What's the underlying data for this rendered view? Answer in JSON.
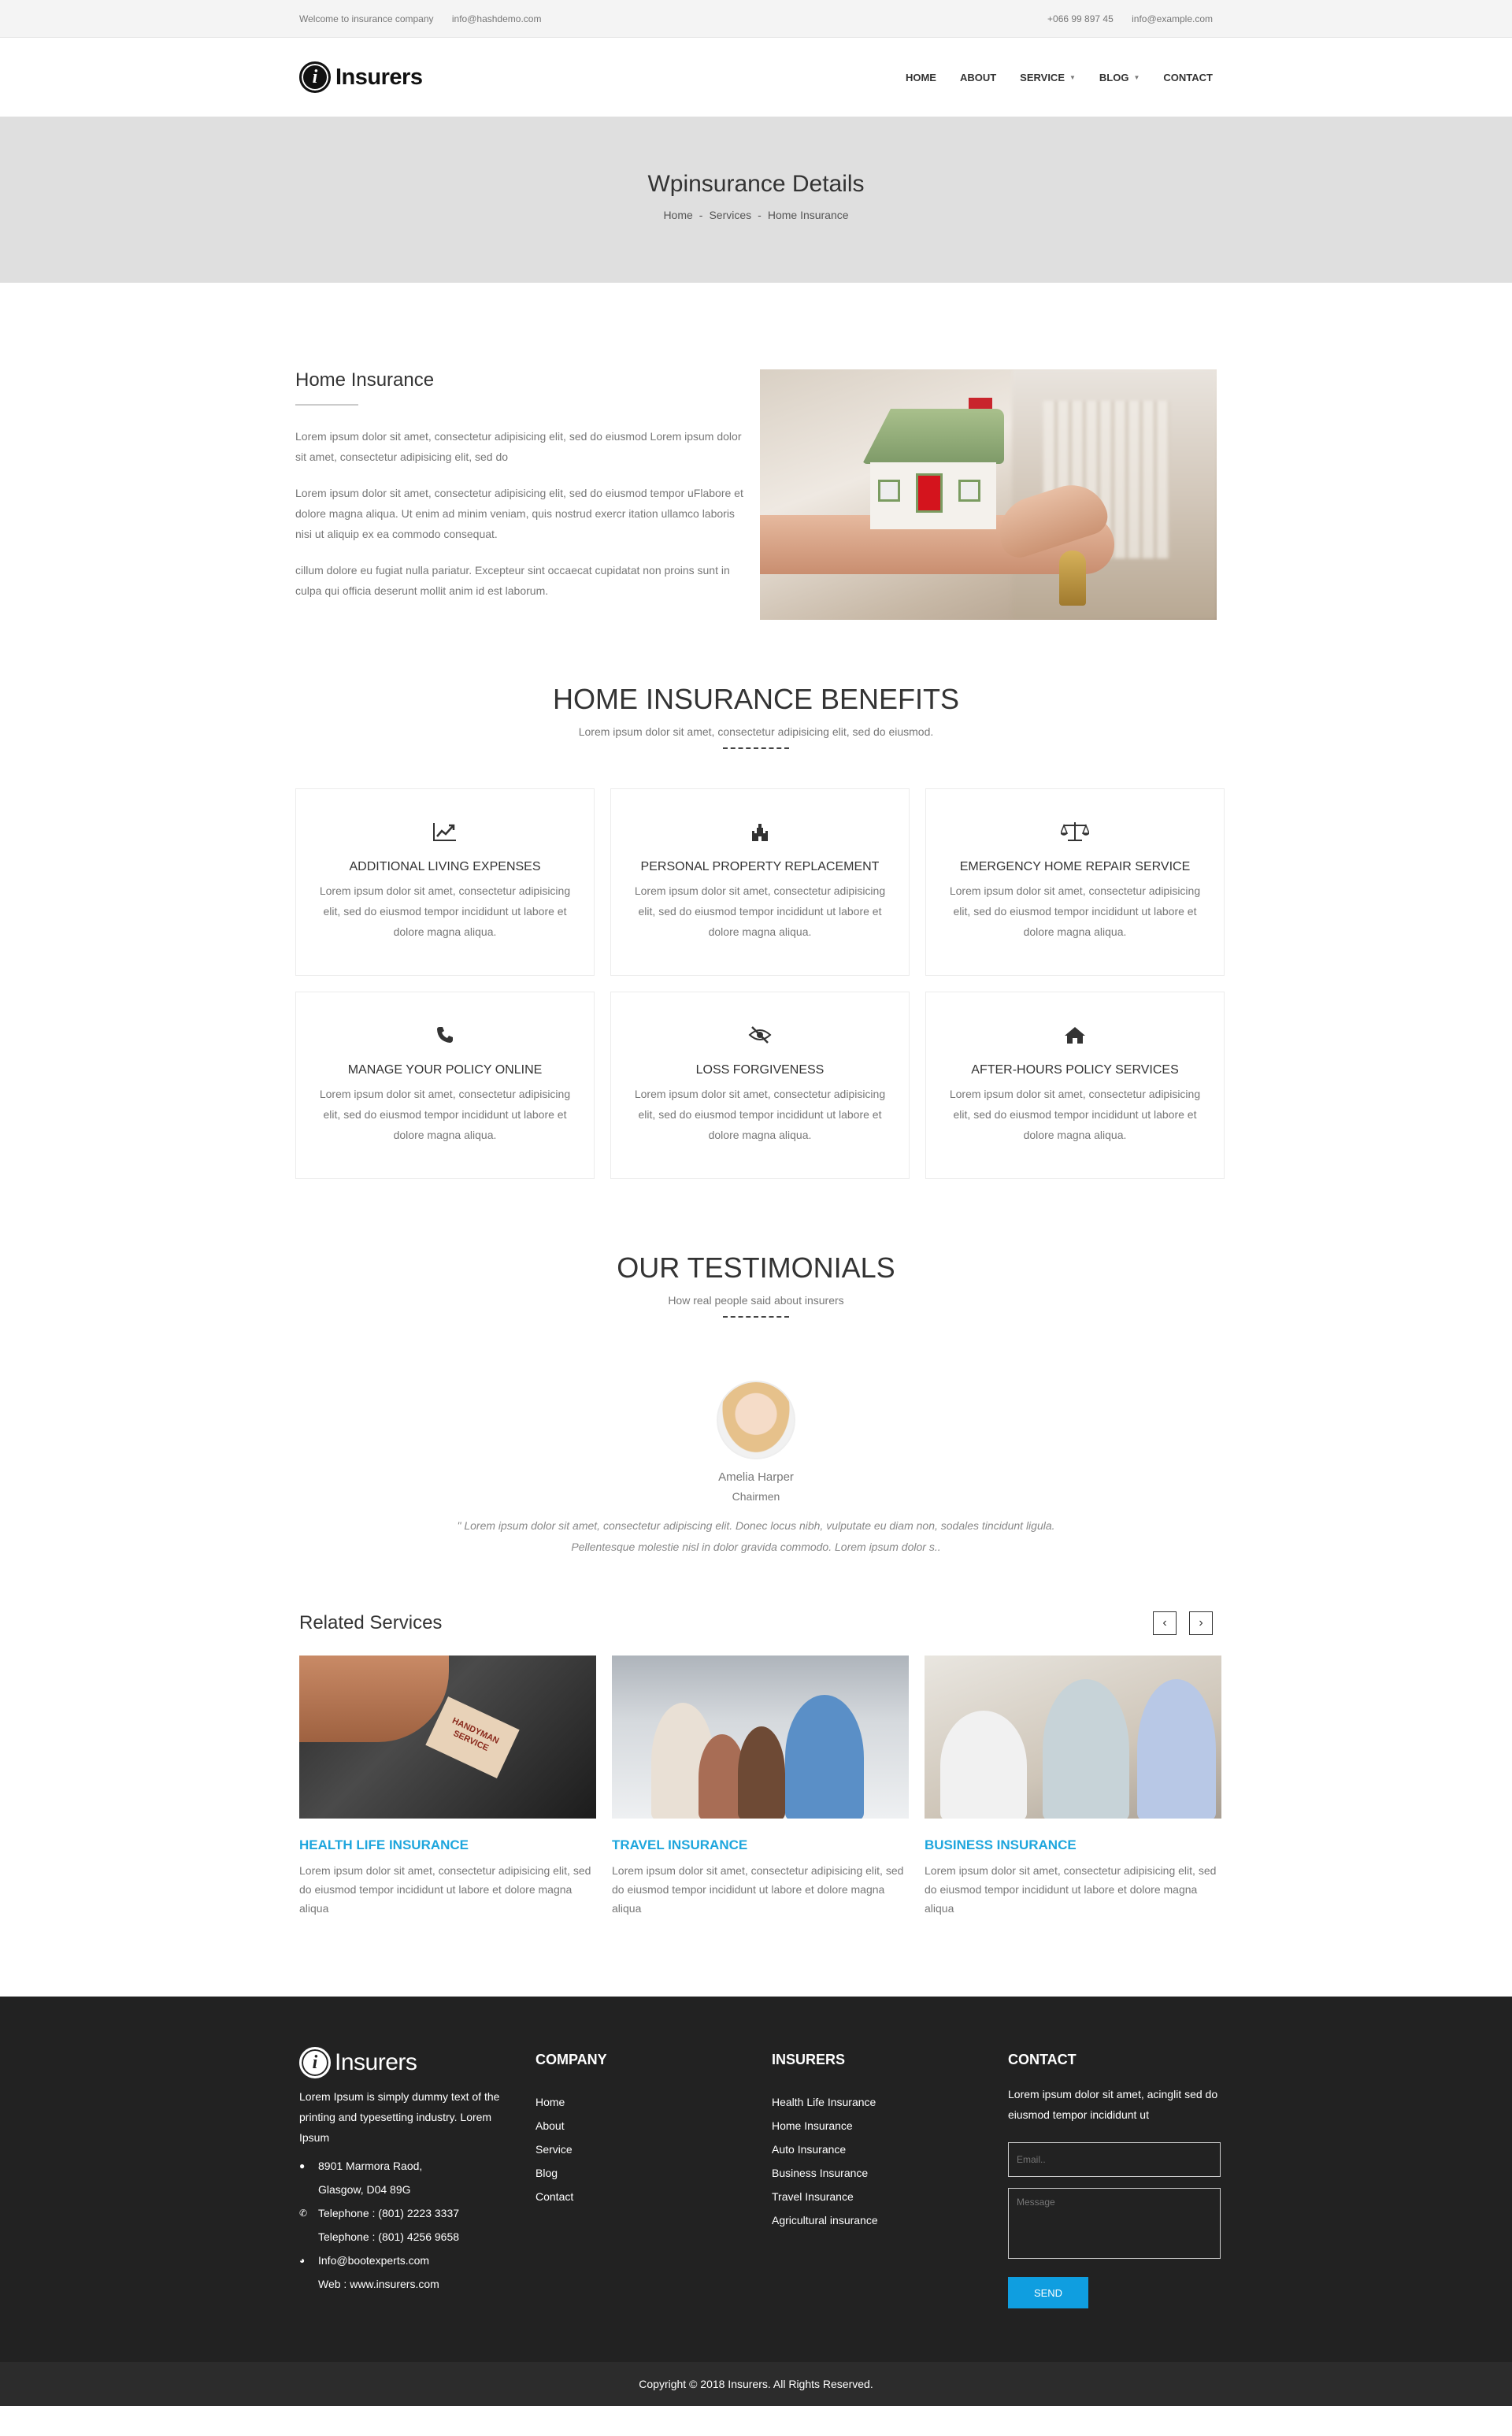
{
  "topbar": {
    "welcome": "Welcome to insurance company",
    "email_left": "info@hashdemo.com",
    "phone": "+066 99 897 45",
    "email_right": "info@example.com"
  },
  "header": {
    "logo_glyph": "i",
    "logo_text": "Insurers",
    "nav": {
      "home": "HOME",
      "about": "ABOUT",
      "service": "SERVICE",
      "blog": "BLOG",
      "contact": "CONTACT"
    }
  },
  "banner": {
    "title": "Wpinsurance Details",
    "breadcrumb": [
      "Home",
      "Services",
      "Home Insurance"
    ],
    "separator": "-"
  },
  "intro": {
    "title": "Home Insurance",
    "paragraphs": [
      "Lorem ipsum dolor sit amet, consectetur adipisicing elit, sed do eiusmod Lorem ipsum dolor sit amet, consectetur adipisicing elit, sed do",
      "Lorem ipsum dolor sit amet, consectetur adipisicing elit, sed do eiusmod tempor uFlabore et dolore magna aliqua. Ut enim ad minim veniam, quis nostrud exercr itation ullamco laboris nisi ut aliquip ex ea commodo consequat.",
      "cillum dolore eu fugiat nulla pariatur. Excepteur sint occaecat cupidatat non proins sunt in culpa qui officia deserunt mollit anim id est laborum."
    ]
  },
  "benefits": {
    "title": "HOME INSURANCE BENEFITS",
    "subtitle": "Lorem ipsum dolor sit amet, consectetur adipisicing elit, sed do eiusmod.",
    "items": [
      {
        "icon": "chart-line-icon",
        "glyph": "📈",
        "title": "ADDITIONAL LIVING EXPENSES",
        "text": "Lorem ipsum dolor sit amet, consectetur adipisicing elit, sed do eiusmod tempor incididunt ut labore et dolore magna aliqua."
      },
      {
        "icon": "castle-icon",
        "glyph": "♜",
        "title": "PERSONAL PROPERTY REPLACEMENT",
        "text": "Lorem ipsum dolor sit amet, consectetur adipisicing elit, sed do eiusmod tempor incididunt ut labore et dolore magna aliqua."
      },
      {
        "icon": "balance-scale-icon",
        "glyph": "⚖",
        "title": "EMERGENCY HOME REPAIR SERVICE",
        "text": "Lorem ipsum dolor sit amet, consectetur adipisicing elit, sed do eiusmod tempor incididunt ut labore et dolore magna aliqua."
      },
      {
        "icon": "phone-icon",
        "glyph": "✆",
        "title": "MANAGE YOUR POLICY ONLINE",
        "text": "Lorem ipsum dolor sit amet, consectetur adipisicing elit, sed do eiusmod tempor incididunt ut labore et dolore magna aliqua."
      },
      {
        "icon": "eye-slash-icon",
        "glyph": "◎",
        "title": "LOSS FORGIVENESS",
        "text": "Lorem ipsum dolor sit amet, consectetur adipisicing elit, sed do eiusmod tempor incididunt ut labore et dolore magna aliqua."
      },
      {
        "icon": "home-icon",
        "glyph": "⌂",
        "title": "AFTER-HOURS POLICY SERVICES",
        "text": "Lorem ipsum dolor sit amet, consectetur adipisicing elit, sed do eiusmod tempor incididunt ut labore et dolore magna aliqua."
      }
    ]
  },
  "testimonials": {
    "title": "OUR TESTIMONIALS",
    "subtitle": "How real people said about insurers",
    "name": "Amelia Harper",
    "role": "Chairmen",
    "quote": "\" Lorem ipsum dolor sit amet, consectetur adipiscing elit. Donec locus nibh, vulputate eu diam non, sodales tincidunt ligula. Pellentesque molestie nisl in dolor gravida commodo. Lorem ipsum dolor s.."
  },
  "related": {
    "title": "Related Services",
    "prev": "‹",
    "next": "›",
    "items": [
      {
        "title": "HEALTH LIFE INSURANCE",
        "text": "Lorem ipsum dolor sit amet, consectetur adipisicing elit, sed do eiusmod tempor incididunt ut labore et dolore magna aliqua",
        "tag": "HANDYMAN SERVICE"
      },
      {
        "title": "TRAVEL INSURANCE",
        "text": "Lorem ipsum dolor sit amet, consectetur adipisicing elit, sed do eiusmod tempor incididunt ut labore et dolore magna aliqua"
      },
      {
        "title": "BUSINESS INSURANCE",
        "text": "Lorem ipsum dolor sit amet, consectetur adipisicing elit, sed do eiusmod tempor incididunt ut labore et dolore magna aliqua"
      }
    ]
  },
  "footer": {
    "logo_text": "Insurers",
    "about": "Lorem Ipsum is simply dummy text of the printing and typesetting industry. Lorem Ipsum",
    "address_1": "8901 Marmora Raod,",
    "address_2": "Glasgow, D04 89G",
    "telephone_1": "Telephone : (801) 2223 3337",
    "telephone_2": "Telephone : (801) 4256 9658",
    "email": "Info@bootexperts.com",
    "web": "Web : www.insurers.com",
    "company": {
      "title": "COMPANY",
      "links": [
        "Home",
        "About",
        "Service",
        "Blog",
        "Contact"
      ]
    },
    "insurers": {
      "title": "INSURERS",
      "links": [
        "Health Life Insurance",
        "Home Insurance",
        "Auto Insurance",
        "Business Insurance",
        "Travel Insurance",
        "Agricultural insurance"
      ]
    },
    "contact": {
      "title": "CONTACT",
      "text": "Lorem ipsum dolor sit amet, acinglit sed do eiusmod tempor incididunt ut",
      "email_placeholder": "Email..",
      "message_placeholder": "Message",
      "send_label": "SEND"
    },
    "copyright": "Copyright © 2018 Insurers. All Rights Reserved."
  },
  "colors": {
    "accent": "#1ea6dd",
    "button": "#0f9ee0",
    "footer_bg": "#222222",
    "banner_bg": "#dfdfdf"
  }
}
